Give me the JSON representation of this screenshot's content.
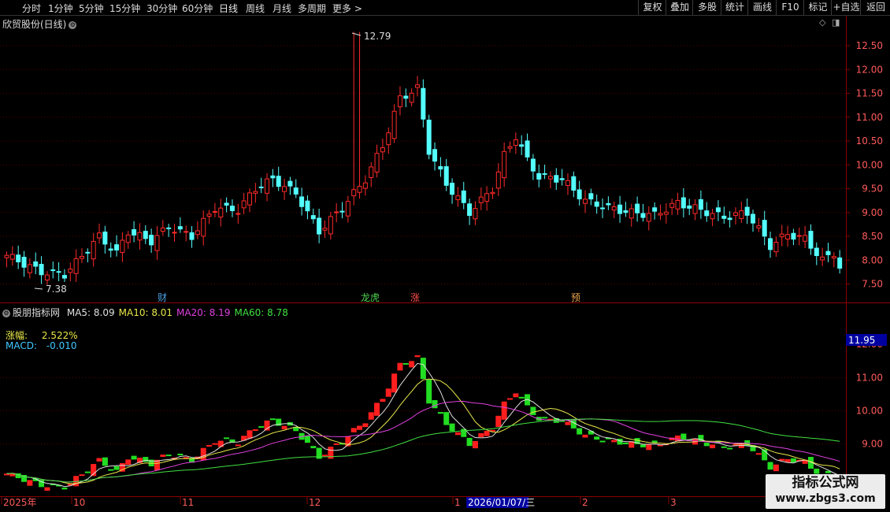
{
  "toolbar": {
    "periods": [
      "分时",
      "1分钟",
      "5分钟",
      "15分钟",
      "30分钟",
      "60分钟",
      "日线",
      "周线",
      "月线",
      "多周期",
      "更多 >"
    ],
    "active": "日线",
    "right_buttons": [
      "复权",
      "叠加",
      "多股",
      "统计",
      "画线",
      "F10",
      "标记",
      "+自选",
      "返回"
    ]
  },
  "main": {
    "stock_title": "欣贸股份(日线)",
    "price_ticks": [
      "12.50",
      "12.00",
      "11.50",
      "11.00",
      "10.50",
      "10.00",
      "9.50",
      "9.00",
      "8.50",
      "8.00",
      "7.50"
    ],
    "high_label": "12.79",
    "low_label": "7.38",
    "event_marks": [
      {
        "label": "财",
        "color": "#4a9ee0"
      },
      {
        "label": "龙虎",
        "color": "#4fd34f"
      },
      {
        "label": "涨",
        "color": "#ff4b4b"
      },
      {
        "label": "预",
        "color": "#e8a24a"
      }
    ]
  },
  "sub": {
    "title": "股朋指标网",
    "ma_labels": [
      {
        "text": "MA5: 8.09",
        "color": "#e0e0e0"
      },
      {
        "text": "MA10: 8.01",
        "color": "#e8e84a"
      },
      {
        "text": "MA20: 8.19",
        "color": "#e040e0"
      },
      {
        "text": "MA60: 8.78",
        "color": "#40e040"
      }
    ],
    "zf_label": "涨幅:",
    "zf_value": "2.522%",
    "macd_label": "MACD:",
    "macd_value": "-0.010",
    "price_ticks": [
      "11.00",
      "10.00",
      "9.00"
    ],
    "cursor_value": "11.95",
    "top_tick_partial": "12.00"
  },
  "xaxis": {
    "labels": [
      "2025年",
      "10",
      "11",
      "12",
      "1",
      "2",
      "3"
    ],
    "cursor_date": "2026/01/07/三"
  },
  "watermark": {
    "title": "指标公式网",
    "url": "www.zbgs3.com"
  },
  "colors": {
    "up": "#ff2a2a",
    "down": "#54ffff",
    "grid": "#550000",
    "axis": "#8a0000"
  }
}
